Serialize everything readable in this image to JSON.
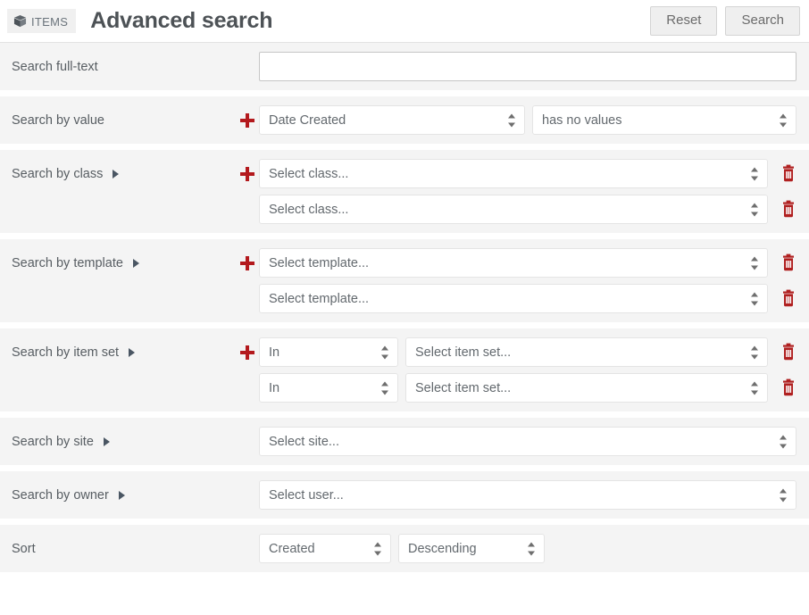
{
  "header": {
    "badge_label": "Items",
    "badge_icon": "cube-icon",
    "title": "Advanced search",
    "reset_label": "Reset",
    "search_label": "Search"
  },
  "colors": {
    "accent_red": "#b3191d",
    "trash_red": "#b02020",
    "row_background": "#f4f4f4",
    "label_text": "#575d62",
    "title_text": "#4d5256"
  },
  "rows": [
    {
      "id": "fulltext",
      "label": "Search full-text",
      "expandable": false,
      "has_add": false,
      "input_value": "",
      "input_placeholder": ""
    },
    {
      "id": "value",
      "label": "Search by value",
      "expandable": false,
      "has_add": true,
      "lines": [
        {
          "property": "Date Created",
          "operator": "has no values"
        }
      ]
    },
    {
      "id": "class",
      "label": "Search by class",
      "expandable": true,
      "has_add": true,
      "lines": [
        {
          "select": "Select class...",
          "trash": "delete-icon"
        },
        {
          "select": "Select class...",
          "trash": "delete-icon"
        }
      ]
    },
    {
      "id": "template",
      "label": "Search by template",
      "expandable": true,
      "has_add": true,
      "lines": [
        {
          "select": "Select template...",
          "trash": "delete-icon"
        },
        {
          "select": "Select template...",
          "trash": "delete-icon"
        }
      ]
    },
    {
      "id": "itemset",
      "label": "Search by item set",
      "expandable": true,
      "has_add": true,
      "lines": [
        {
          "in": "In",
          "select": "Select item set...",
          "trash": "delete-icon"
        },
        {
          "in": "In",
          "select": "Select item set...",
          "trash": "delete-icon"
        }
      ]
    },
    {
      "id": "site",
      "label": "Search by site",
      "expandable": true,
      "has_add": false,
      "lines": [
        {
          "select": "Select site..."
        }
      ]
    },
    {
      "id": "owner",
      "label": "Search by owner",
      "expandable": true,
      "has_add": false,
      "lines": [
        {
          "select": "Select user..."
        }
      ]
    },
    {
      "id": "sort",
      "label": "Sort",
      "expandable": false,
      "has_add": false,
      "sort_by": "Created",
      "sort_dir": "Descending"
    }
  ]
}
